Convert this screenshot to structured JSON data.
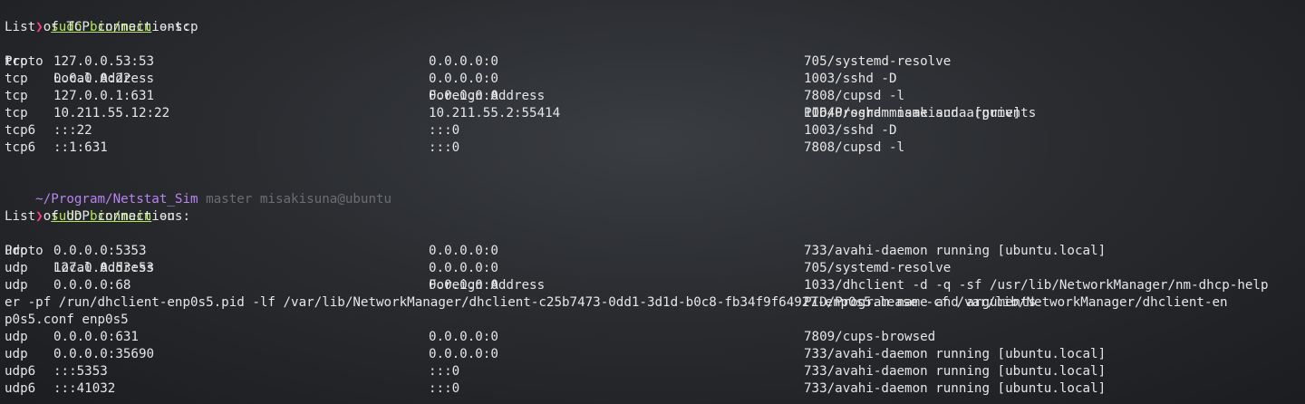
{
  "tcp": {
    "prompt_symbol": "❯",
    "command": "sudo bin/main",
    "args": " --tcp",
    "title": "List of TCP connections:",
    "headers": [
      "Proto",
      "Local Address",
      "Foreign Address",
      "PID/Program name and arguments"
    ],
    "rows": [
      [
        "tcp",
        "127.0.0.53:53",
        "0.0.0.0:0",
        "705/systemd-resolve"
      ],
      [
        "tcp",
        "0.0.0.0:22",
        "0.0.0.0:0",
        "1003/sshd -D"
      ],
      [
        "tcp",
        "127.0.0.1:631",
        "0.0.0.0:0",
        "7808/cupsd -l"
      ],
      [
        "tcp",
        "10.211.55.12:22",
        "10.211.55.2:55414",
        "10640/sshd misakisuna [priv]"
      ],
      [
        "tcp6",
        ":::22",
        ":::0",
        "1003/sshd -D"
      ],
      [
        "tcp6",
        "::1:631",
        ":::0",
        "7808/cupsd -l"
      ]
    ]
  },
  "prompt2": {
    "path": "~/Program/Netstat_Sim",
    "git": " master misakisuna@ubuntu"
  },
  "udp": {
    "prompt_symbol": "❯",
    "command": "sudo bin/main",
    "args": " -u",
    "title": "List of UDP connections:",
    "headers": [
      "Proto",
      "Local Address",
      "Foreign Address",
      "PID/Program name and arguments"
    ],
    "rows_a": [
      [
        "udp",
        "0.0.0.0:5353",
        "0.0.0.0:0",
        "733/avahi-daemon running [ubuntu.local]"
      ],
      [
        "udp",
        "127.0.0.53:53",
        "0.0.0.0:0",
        "705/systemd-resolve"
      ],
      [
        "udp",
        "0.0.0.0:68",
        "0.0.0.0:0",
        "1033/dhclient -d -q -sf /usr/lib/NetworkManager/nm-dhcp-help"
      ]
    ],
    "wrap_lines": [
      "er -pf /run/dhclient-enp0s5.pid -lf /var/lib/NetworkManager/dhclient-c25b7473-0dd1-3d1d-b0c8-fb34f9f64927-enp0s5.lease -cf /var/lib/NetworkManager/dhclient-en",
      "p0s5.conf enp0s5"
    ],
    "rows_b": [
      [
        "udp",
        "0.0.0.0:631",
        "0.0.0.0:0",
        "7809/cups-browsed"
      ],
      [
        "udp",
        "0.0.0.0:35690",
        "0.0.0.0:0",
        "733/avahi-daemon running [ubuntu.local]"
      ],
      [
        "udp6",
        ":::5353",
        ":::0",
        "733/avahi-daemon running [ubuntu.local]"
      ],
      [
        "udp6",
        ":::41032",
        ":::0",
        "733/avahi-daemon running [ubuntu.local]"
      ]
    ]
  }
}
